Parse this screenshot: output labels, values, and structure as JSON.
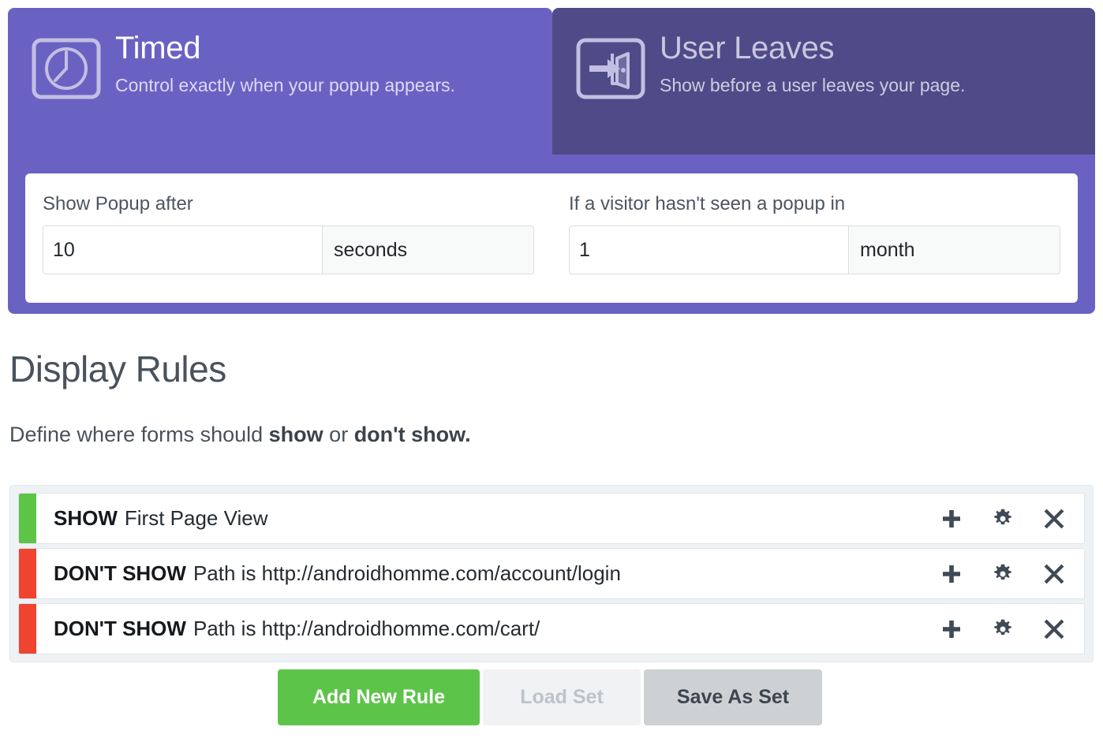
{
  "trigger": {
    "tabs": [
      {
        "id": "timed",
        "title": "Timed",
        "subtitle": "Control exactly when your popup appears.",
        "icon": "clock-icon",
        "active": true
      },
      {
        "id": "user-leaves",
        "title": "User Leaves",
        "subtitle": "Show before a user leaves your page.",
        "icon": "exit-door-icon",
        "active": false
      }
    ],
    "fields": [
      {
        "label": "Show Popup after",
        "value": "10",
        "placeholder": "",
        "unit": "seconds"
      },
      {
        "label": "If a visitor hasn't seen a popup in",
        "value": "1",
        "placeholder": "",
        "unit": "month"
      }
    ]
  },
  "display_rules": {
    "heading": "Display Rules",
    "subtitle_prefix": "Define where forms should ",
    "subtitle_show": "show",
    "subtitle_middle": " or ",
    "subtitle_dont_show": "don't show.",
    "rules": [
      {
        "action": "SHOW",
        "description": "First Page View",
        "type": "show",
        "color": "#5dc446"
      },
      {
        "action": "DON'T SHOW",
        "description": "Path is http://androidhomme.com/account/login",
        "type": "dont-show",
        "color": "#ef4430"
      },
      {
        "action": "DON'T SHOW",
        "description": "Path is http://androidhomme.com/cart/",
        "type": "dont-show",
        "color": "#ef4430"
      }
    ],
    "row_actions": [
      {
        "name": "add-icon",
        "glyph": "plus"
      },
      {
        "name": "settings-gear-icon",
        "glyph": "gear"
      },
      {
        "name": "delete-icon",
        "glyph": "close"
      }
    ],
    "buttons": {
      "add_new_rule": "Add New Rule",
      "load_set": "Load Set",
      "save_as_set": "Save As Set"
    }
  },
  "colors": {
    "tab_active": "#6a62c3",
    "tab_inactive": "#4e4b88",
    "green": "#5dc44a",
    "red": "#ef4430",
    "grey_button": "#cdd1d4",
    "disabled_button": "#f0f2f4"
  }
}
